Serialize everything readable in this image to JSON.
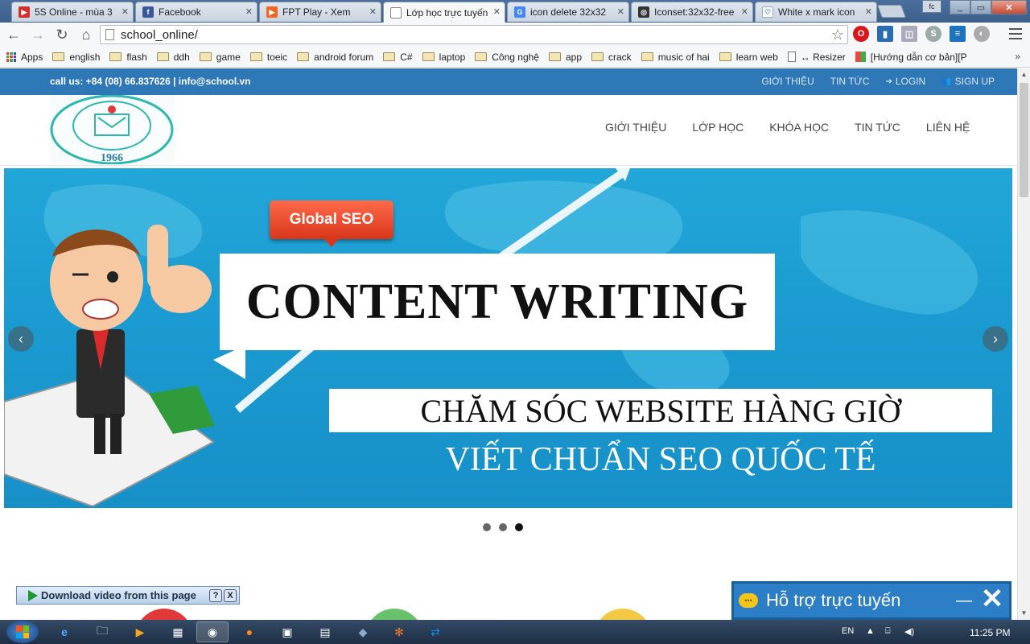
{
  "browser": {
    "tabs": [
      {
        "title": "5S Online - mùa 3",
        "favicon_color": "#d32f2f",
        "favicon_glyph": "▶"
      },
      {
        "title": "Facebook",
        "favicon_color": "#3b5998",
        "favicon_glyph": "f"
      },
      {
        "title": "FPT Play - Xem",
        "favicon_color": "#f26522",
        "favicon_glyph": "▶"
      },
      {
        "title": "Lớp học trực tuyến",
        "favicon_color": "#ffffff",
        "favicon_glyph": ""
      },
      {
        "title": "icon delete 32x32",
        "favicon_color": "#4285f4",
        "favicon_glyph": "G"
      },
      {
        "title": "Iconset:32x32-free",
        "favicon_color": "#333333",
        "favicon_glyph": "◎"
      },
      {
        "title": "White x mark icon",
        "favicon_color": "#ffffff",
        "favicon_glyph": "♡"
      }
    ],
    "active_tab_index": 3,
    "profile_label": "fc",
    "url": "school_online/",
    "bookmarks": [
      {
        "label": "Apps",
        "kind": "apps"
      },
      {
        "label": "english",
        "kind": "folder"
      },
      {
        "label": "flash",
        "kind": "folder"
      },
      {
        "label": "ddh",
        "kind": "folder"
      },
      {
        "label": "game",
        "kind": "folder"
      },
      {
        "label": "toeic",
        "kind": "folder"
      },
      {
        "label": "android forum",
        "kind": "folder"
      },
      {
        "label": "C#",
        "kind": "folder"
      },
      {
        "label": "laptop",
        "kind": "folder"
      },
      {
        "label": "Công nghệ",
        "kind": "folder"
      },
      {
        "label": "app",
        "kind": "folder"
      },
      {
        "label": "crack",
        "kind": "folder"
      },
      {
        "label": "music of hai",
        "kind": "folder"
      },
      {
        "label": "learn web",
        "kind": "folder"
      },
      {
        "label": "↔ Resizer",
        "kind": "file"
      },
      {
        "label": "[Hướng dẫn cơ bản][P",
        "kind": "windows"
      }
    ],
    "bookmarks_more": "»"
  },
  "site": {
    "contact": "call us: +84 (08) 66.837626 | info@school.vn",
    "topnav": {
      "about": "GIỚI THIỆU",
      "news": "TIN TỨC",
      "login": "LOGIN",
      "signup": "SIGN UP"
    },
    "logo_year": "1966",
    "mainnav": [
      "GIỚI THIỆU",
      "LỚP HỌC",
      "KHÓA HỌC",
      "TIN TỨC",
      "LIÊN HỆ"
    ],
    "slider": {
      "badge": "Global SEO",
      "headline": "CONTENT WRITING",
      "subheadline": "CHĂM SÓC WEBSITE HÀNG GIỜ",
      "tagline": "VIẾT CHUẨN SEO QUỐC TẾ",
      "slide_count": 3,
      "active_slide": 3
    },
    "download_bar": {
      "label": "Download video from this page",
      "help": "?",
      "close": "X"
    },
    "support": {
      "title": "Hỗ trợ trực tuyến",
      "minimize": "—",
      "close": "✕"
    }
  },
  "taskbar": {
    "language": "EN",
    "time": "11:25 PM"
  },
  "colors": {
    "topbar": "#2f78b8",
    "slider_blue": "#1b9bd1",
    "badge_red": "#e8462a",
    "support_blue": "#2c7fc6"
  }
}
